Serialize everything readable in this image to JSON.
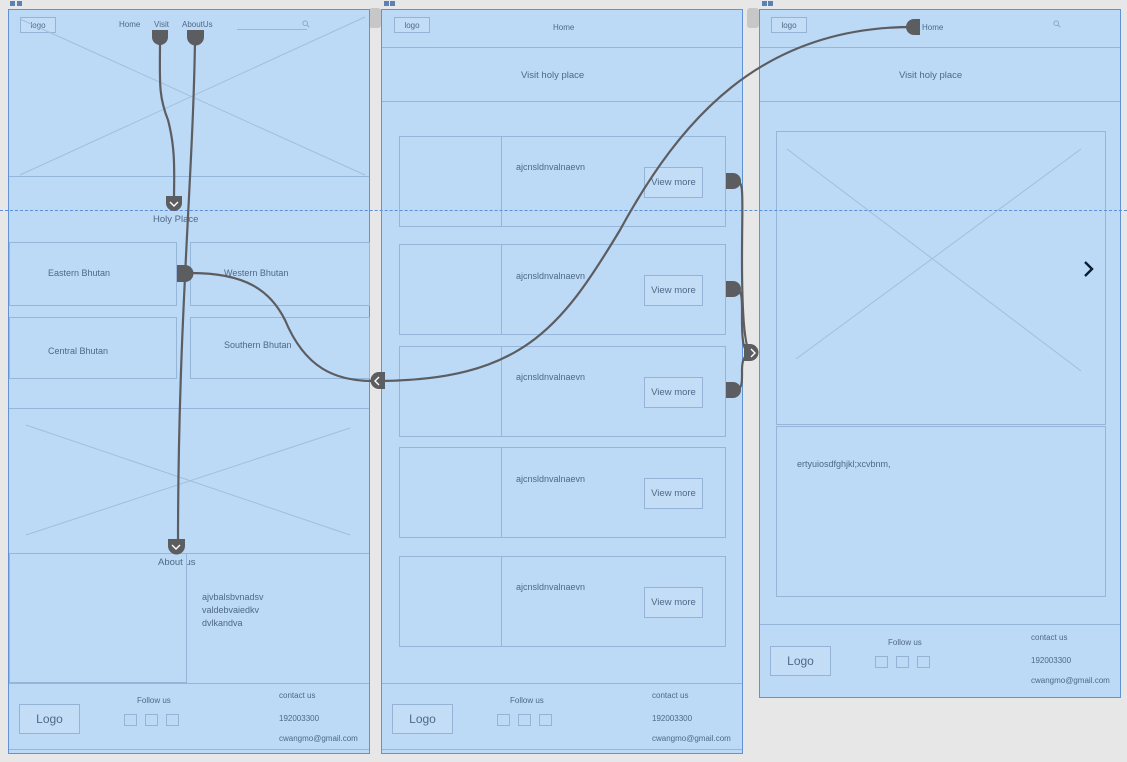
{
  "colors": {
    "canvas": "#e7e7e7",
    "board_fill": "#bcd9f6",
    "board_border": "#5f93d6",
    "connector": "#5c5d61",
    "guide": "#5b90d8"
  },
  "screen1": {
    "nav": {
      "logo": "logo",
      "home": "Home",
      "visit": "Visit",
      "about": "AboutUs",
      "search_icon": "search-icon"
    },
    "holy_place": "Holy Place",
    "regions": [
      "Eastern Bhutan",
      "Western Bhutan",
      "Central Bhutan",
      "Southern Bhutan"
    ],
    "about_title": "About us",
    "about_text": [
      "ajvbalsbvnadsv",
      "valdebvaiedkv",
      "dvlkandva"
    ],
    "footer": {
      "logo": "Logo",
      "follow": "Follow us",
      "contact": "contact us",
      "phone": "192003300",
      "email": "cwangmo@gmail.com"
    }
  },
  "screen2": {
    "nav": {
      "logo": "logo",
      "home": "Home"
    },
    "title": "Visit holy place",
    "cards": [
      {
        "text": "ajcnsldnvalnaevn",
        "button": "View more"
      },
      {
        "text": "ajcnsldnvalnaevn",
        "button": "View more"
      },
      {
        "text": "ajcnsldnvalnaevn",
        "button": "View more"
      },
      {
        "text": "ajcnsldnvalnaevn",
        "button": "View more"
      },
      {
        "text": "ajcnsldnvalnaevn",
        "button": "View more"
      }
    ],
    "footer": {
      "logo": "Logo",
      "follow": "Follow us",
      "contact": "contact us",
      "phone": "192003300",
      "email": "cwangmo@gmail.com"
    }
  },
  "screen3": {
    "nav": {
      "logo": "logo",
      "home": "Home",
      "search_icon": "search-icon"
    },
    "title": "Visit holy place",
    "next_icon": "chevron-right-icon",
    "description": "ertyuiosdfghjkl;xcvbnm,",
    "footer": {
      "logo": "Logo",
      "follow": "Follow us",
      "contact": "contact us",
      "phone": "192003300",
      "email": "cwangmo@gmail.com"
    }
  }
}
